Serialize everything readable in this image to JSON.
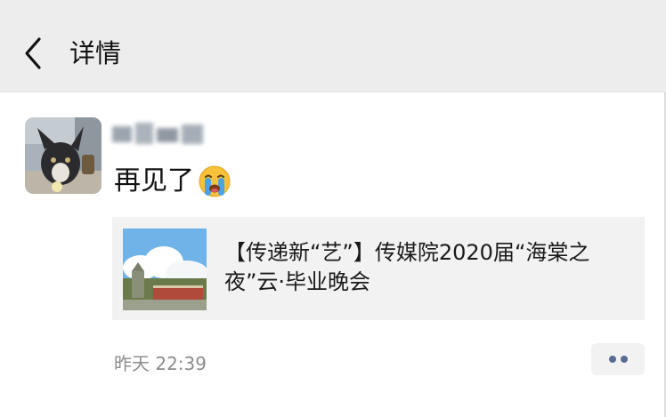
{
  "header": {
    "back_icon": "chevron-left-icon",
    "title": "详情"
  },
  "post": {
    "avatar_icon": "avatar-photo",
    "nickname": "",
    "text": "再见了",
    "emoji": "loudly-crying-face-icon",
    "link_card": {
      "thumbnail": "campus-photo",
      "title": "【传递新“艺”】传媒院2020届“海棠之夜”云·毕业晚会"
    },
    "timestamp": "昨天 22:39",
    "more_icon": "more-dots-icon"
  },
  "colors": {
    "header_bg": "#ededed",
    "card_bg": "#f2f2f2",
    "more_dots": "#576b95",
    "timestamp": "#8c8c8c"
  }
}
